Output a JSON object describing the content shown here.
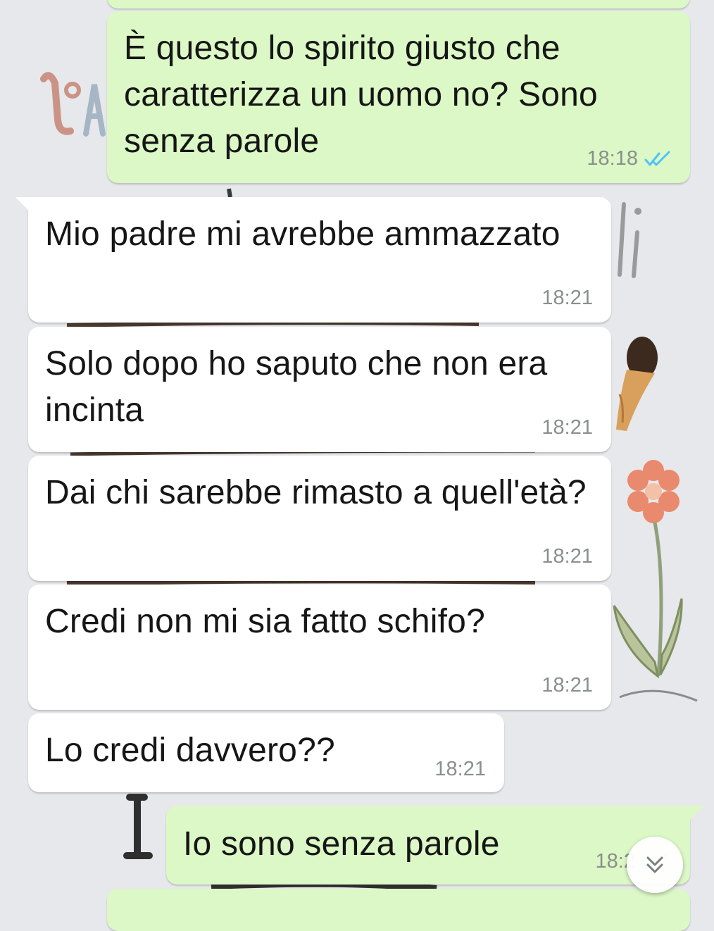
{
  "messages": [
    {
      "direction": "outgoing",
      "text": "È questo lo spirito giusto che caratterizza un uomo no? Sono senza parole",
      "time": "18:18",
      "status": "read"
    },
    {
      "direction": "incoming",
      "text": "Mio padre mi avrebbe ammazzato",
      "time": "18:21"
    },
    {
      "direction": "incoming",
      "text": "Solo dopo ho saputo che non era incinta",
      "time": "18:21"
    },
    {
      "direction": "incoming",
      "text": "Dai chi sarebbe rimasto a quell'età?",
      "time": "18:21"
    },
    {
      "direction": "incoming",
      "text": "Credi non mi sia fatto schifo?",
      "time": "18:21"
    },
    {
      "direction": "incoming",
      "text": "Lo credi davvero??",
      "time": "18:21"
    },
    {
      "direction": "outgoing",
      "text": "Io sono senza parole",
      "time": "18:2",
      "status": "read"
    }
  ],
  "colors": {
    "outgoing_bubble": "#dcf8c6",
    "incoming_bubble": "#ffffff",
    "read_ticks": "#4fc3f7",
    "time_text": "#8a8f8c"
  },
  "icons": {
    "read_receipt": "double-check-icon",
    "scroll_down": "chevron-double-down-icon"
  }
}
